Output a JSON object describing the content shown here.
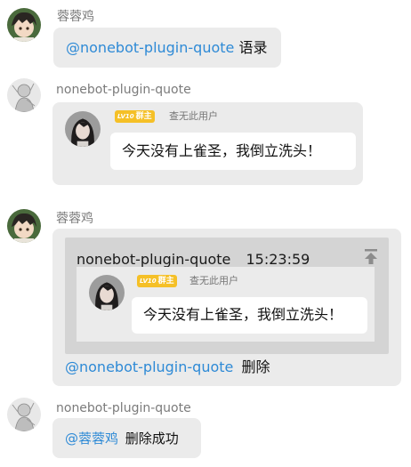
{
  "messages": [
    {
      "sender": "蓉蓉鸡",
      "mention": "@nonebot-plugin-quote",
      "text": "语录"
    },
    {
      "sender": "nonebot-plugin-quote",
      "quote": {
        "badge_level": "LV10",
        "badge_role": "群主",
        "user_label": "查无此用户",
        "text": "今天没有上雀圣，我倒立洗头！"
      }
    },
    {
      "sender": "蓉蓉鸡",
      "reply": {
        "header_name": "nonebot-plugin-quote",
        "header_time": "15:23:59",
        "badge_level": "LV10",
        "badge_role": "群主",
        "user_label": "查无此用户",
        "text": "今天没有上雀圣，我倒立洗头！"
      },
      "mention": "@nonebot-plugin-quote",
      "text": "删除"
    },
    {
      "sender": "nonebot-plugin-quote",
      "mention": "@蓉蓉鸡",
      "text": "删除成功"
    }
  ],
  "icons": {
    "jump_to_quote": "arrow-up-to-top-icon",
    "avatar_a": "anime-boy-avatar",
    "avatar_b": "sketch-character-avatar",
    "avatar_c": "dark-hair-girl-avatar"
  },
  "colors": {
    "mention": "#2e8ad6",
    "bubble": "#ebebeb",
    "badge": "#f5c027",
    "reply_panel": "#d4d4d4"
  }
}
